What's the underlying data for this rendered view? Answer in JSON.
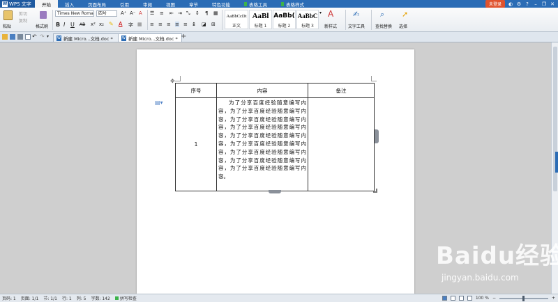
{
  "app": {
    "name": "WPS 文字",
    "login": "未登录"
  },
  "menu": {
    "tabs": [
      "开始",
      "插入",
      "页面布局",
      "引用",
      "审阅",
      "视图",
      "章节",
      "特色功能"
    ],
    "context_tabs": [
      "表格工具",
      "表格样式"
    ],
    "active": "开始"
  },
  "ribbon": {
    "paste": "粘贴",
    "cut": "剪切",
    "copy": "复制",
    "format_painter": "格式刷",
    "font": "Times New Roma",
    "size": "四号",
    "styles": [
      {
        "sample": "AaBbCcDt",
        "name": "正文"
      },
      {
        "sample": "AaBl",
        "name": "标题 1"
      },
      {
        "sample": "AaBb(",
        "name": "标题 2"
      },
      {
        "sample": "AaBbC",
        "name": "标题 3"
      }
    ],
    "new_style": "新样式",
    "text_tools": "文字工具",
    "find_replace": "查找替换",
    "select": "选择"
  },
  "doc_tabs": [
    {
      "label": "新建 Micro...文档.doc *",
      "active": false
    },
    {
      "label": "新建 Micro...文档.doc *",
      "active": true
    }
  ],
  "table": {
    "headers": [
      "序号",
      "内容",
      "备注"
    ],
    "rows": [
      {
        "num": "1",
        "content": "为了分享百度经验随意编写内容，为了分享百度经验随意编写内容，为了分享百度经验随意编写内容，为了分享百度经验随意编写内容，为了分享百度经验随意编写内容，为了分享百度经验随意编写内容，为了分享百度经验随意编写内容，为了分享百度经验随意编写内容，为了分享百度经验随意编写内容。",
        "note": ""
      }
    ]
  },
  "status": {
    "page": "页码: 1",
    "pages": "页面: 1/1",
    "section": "节: 1/1",
    "row": "行: 1",
    "col": "列: 5",
    "words": "字数: 142",
    "spell": "拼写检查",
    "zoom": "100 %",
    "zoom_level": 0.5
  },
  "watermark": {
    "brand": "Baidu经验",
    "url": "jingyan.baidu.com"
  },
  "colors": {
    "title_bar": "#2b6cb5",
    "login": "#e0532e",
    "context_tab": "#3db34a"
  }
}
